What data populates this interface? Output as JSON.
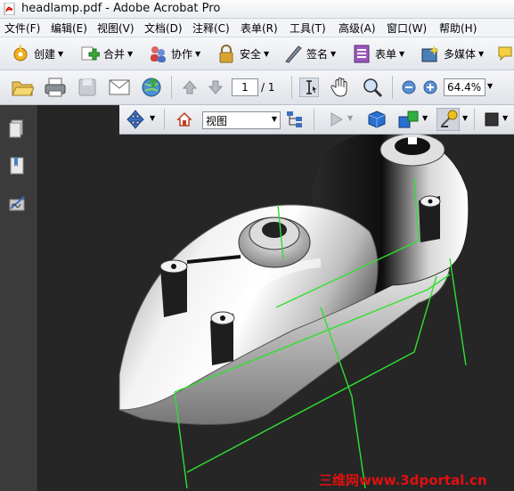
{
  "window": {
    "title": "headlamp.pdf - Adobe Acrobat Pro"
  },
  "menu": [
    "文件(F)",
    "编辑(E)",
    "视图(V)",
    "文档(D)",
    "注释(C)",
    "表单(R)",
    "工具(T)",
    "高级(A)",
    "窗口(W)",
    "帮助(H)"
  ],
  "toolbar1": {
    "create": "创建",
    "combine": "合并",
    "collaborate": "协作",
    "secure": "安全",
    "sign": "签名",
    "forms": "表单",
    "multimedia": "多媒体"
  },
  "toolbar2": {
    "page_current": "1",
    "page_total": "/ 1",
    "zoom": "64.4%"
  },
  "toolbar3d": {
    "view_select": "视图"
  },
  "watermark": "三维网www.3dportal.cn",
  "colors": {
    "accent_green": "#2fe02f",
    "watermark_red": "#e01010"
  }
}
